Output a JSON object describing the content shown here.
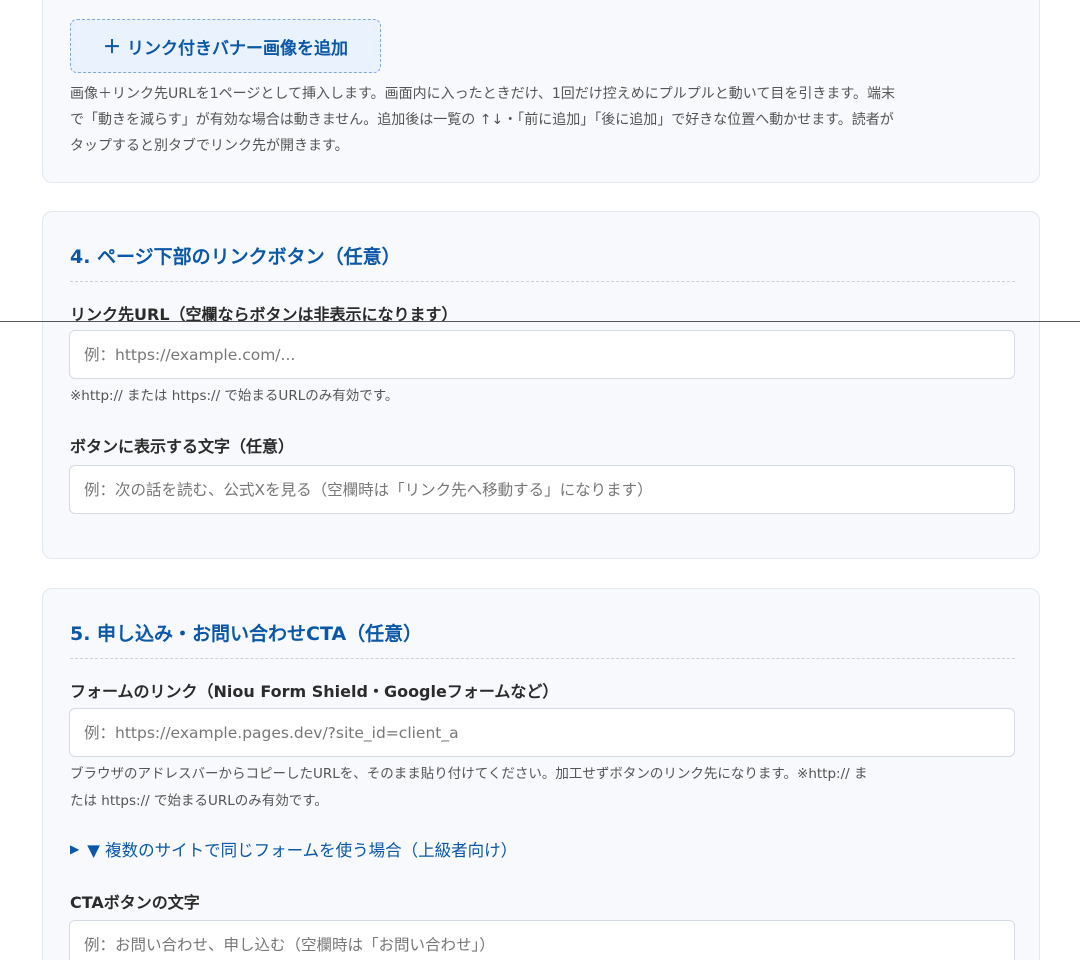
{
  "banner_section": {
    "add_button_icon": "plus-icon",
    "add_button_label": "リンク付きバナー画像を追加",
    "help_line1": "画像＋リンク先URLを1ページとして挿入します。画面内に入ったときだけ、1回だけ控えめにプルプルと動いて目を引きます。端末",
    "help_line2": "で「動きを減らす」が有効な場合は動きません。追加後は一覧の ↑↓・「前に追加」「後に追加」で好きな位置へ動かせます。読者が",
    "help_line3": "タップすると別タブでリンク先が開きます。"
  },
  "section4": {
    "title": "4. ページ下部のリンクボタン（任意）",
    "url_label": "リンク先URL（空欄ならボタンは非表示になります）",
    "url_value": "",
    "url_placeholder": "例：https://example.com/...",
    "url_note": "※http:// または https:// で始まるURLのみ有効です。",
    "text_label": "ボタンに表示する文字（任意）",
    "text_value": "",
    "text_placeholder": "例：次の話を読む、公式Xを見る（空欄時は「リンク先へ移動する」になります）"
  },
  "section5": {
    "title": "5. 申し込み・お問い合わせCTA（任意）",
    "form_label": "フォームのリンク（Niou Form Shield・Googleフォームなど）",
    "form_value": "",
    "form_placeholder": "例：https://example.pages.dev/?site_id=client_a",
    "form_note_line1": "ブラウザのアドレスバーからコピーしたURLを、そのまま貼り付けてください。加工せずボタンのリンク先になります。※http:// ま",
    "form_note_line2": "たは https:// で始まるURLのみ有効です。",
    "advanced_toggle_icon": "triangle-right-icon",
    "advanced_toggle_label": "▼ 複数のサイトで同じフォームを使う場合（上級者向け）",
    "cta_label": "CTAボタンの文字",
    "cta_value": "",
    "cta_placeholder": "例：お問い合わせ、申し込む（空欄時は「お問い合わせ」）"
  },
  "colors": {
    "accent": "#0b57a8",
    "card_bg": "#f7f9fc",
    "card_border": "#e3e8ef",
    "button_bg": "#e9f2fd"
  }
}
